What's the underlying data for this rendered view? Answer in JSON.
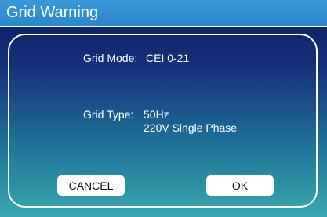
{
  "window": {
    "title": "Grid Warning"
  },
  "grid_mode": {
    "label": "Grid Mode:",
    "value": "CEI 0-21"
  },
  "grid_type": {
    "label": "Grid Type:",
    "frequency": "50Hz",
    "phase": "220V Single Phase"
  },
  "buttons": {
    "cancel_label": "CANCEL",
    "ok_label": "OK"
  },
  "colors": {
    "title_bar": "#2a86cc",
    "background_top": "#0b1c5e",
    "background_bottom": "#3aa7b0",
    "text": "#ffffff",
    "button": "#ffffff"
  }
}
